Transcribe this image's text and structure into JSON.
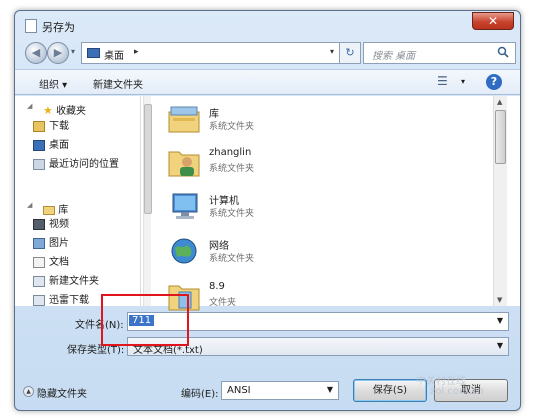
{
  "window": {
    "title": "另存为",
    "close_glyph": "✕"
  },
  "navigation": {
    "back_glyph": "◀",
    "forward_glyph": "▶",
    "history_glyph": "▾",
    "address": {
      "location": "桌面",
      "separator": "▸",
      "dropdown_glyph": "▾"
    },
    "refresh_glyph": "↻",
    "search": {
      "placeholder": "搜索 桌面",
      "icon": "search-icon"
    }
  },
  "toolbar": {
    "organize_label": "组织 ▾",
    "new_folder_label": "新建文件夹",
    "view_glyph": "☰",
    "view_drop": "▾",
    "help_glyph": "?"
  },
  "nav_pane": {
    "favorites": {
      "label": "收藏夹",
      "items": [
        "下载",
        "桌面",
        "最近访问的位置"
      ]
    },
    "libraries": {
      "label": "库",
      "items": [
        "视频",
        "图片",
        "文档",
        "新建文件夹",
        "迅雷下载"
      ]
    }
  },
  "files": [
    {
      "name": "库",
      "type": "系统文件夹",
      "icon": "library-icon"
    },
    {
      "name": "zhanglin",
      "type": "系统文件夹",
      "icon": "user-folder-icon"
    },
    {
      "name": "计算机",
      "type": "系统文件夹",
      "icon": "computer-icon"
    },
    {
      "name": "网络",
      "type": "系统文件夹",
      "icon": "network-icon"
    },
    {
      "name": "8.9",
      "type": "文件夹",
      "icon": "folder-icon"
    }
  ],
  "form": {
    "filename_label": "文件名(N):",
    "filename_value": "711",
    "filetype_label": "保存类型(T):",
    "filetype_value": "文本文档(*.txt)",
    "hide_folders_label": "隐藏文件夹",
    "encoding_label": "编码(E):",
    "encoding_value": "ANSI",
    "save_label": "保存(S)",
    "cancel_label": "取消"
  },
  "watermark": {
    "line1": "中关村在线",
    "line2": "zol.com.cn"
  },
  "colors": {
    "highlight": "#3c74c9",
    "annotation_red": "#e0161c",
    "frame": "#c7dcf2"
  }
}
